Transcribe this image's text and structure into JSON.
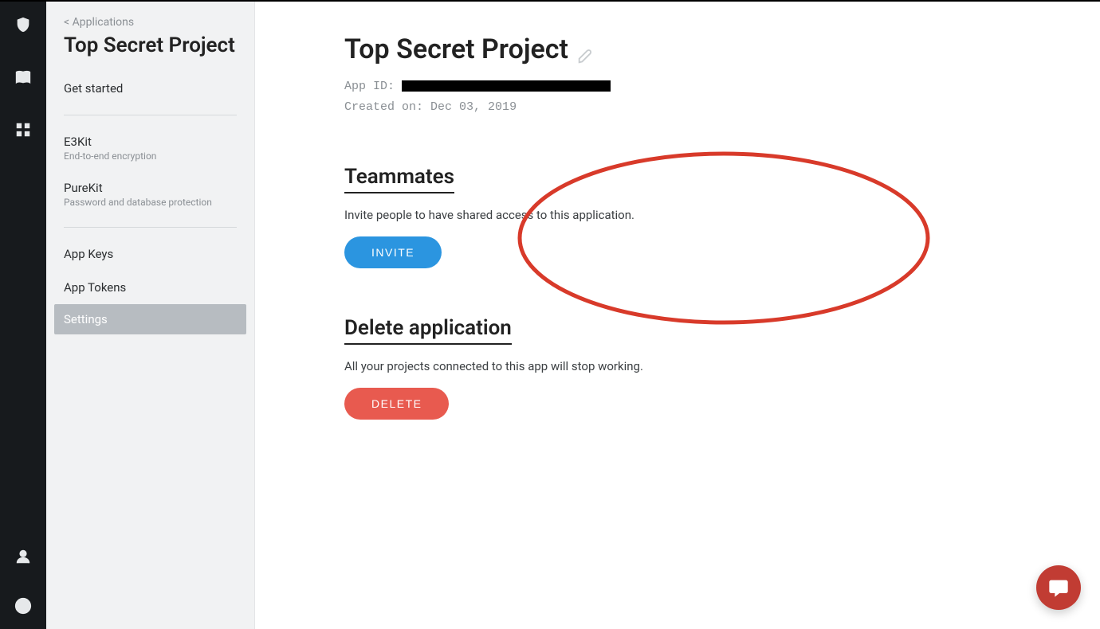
{
  "subnav": {
    "back_label": "<  Applications",
    "title": "Top Secret Project",
    "items": [
      {
        "label": "Get started",
        "sub": "",
        "active": false
      },
      {
        "label": "E3Kit",
        "sub": "End-to-end encryption",
        "active": false
      },
      {
        "label": "PureKit",
        "sub": "Password and database protection",
        "active": false
      },
      {
        "label": "App Keys",
        "sub": "",
        "active": false
      },
      {
        "label": "App Tokens",
        "sub": "",
        "active": false
      },
      {
        "label": "Settings",
        "sub": "",
        "active": true
      }
    ]
  },
  "main": {
    "title": "Top Secret Project",
    "app_id_label": "App ID:",
    "created_label": "Created on:",
    "created_value": "Dec 03, 2019",
    "teammates": {
      "heading": "Teammates",
      "desc": "Invite people to have shared access to this application.",
      "button": "INVITE"
    },
    "delete": {
      "heading": "Delete application",
      "desc": "All your projects connected to this app will stop working.",
      "button": "DELETE"
    }
  }
}
